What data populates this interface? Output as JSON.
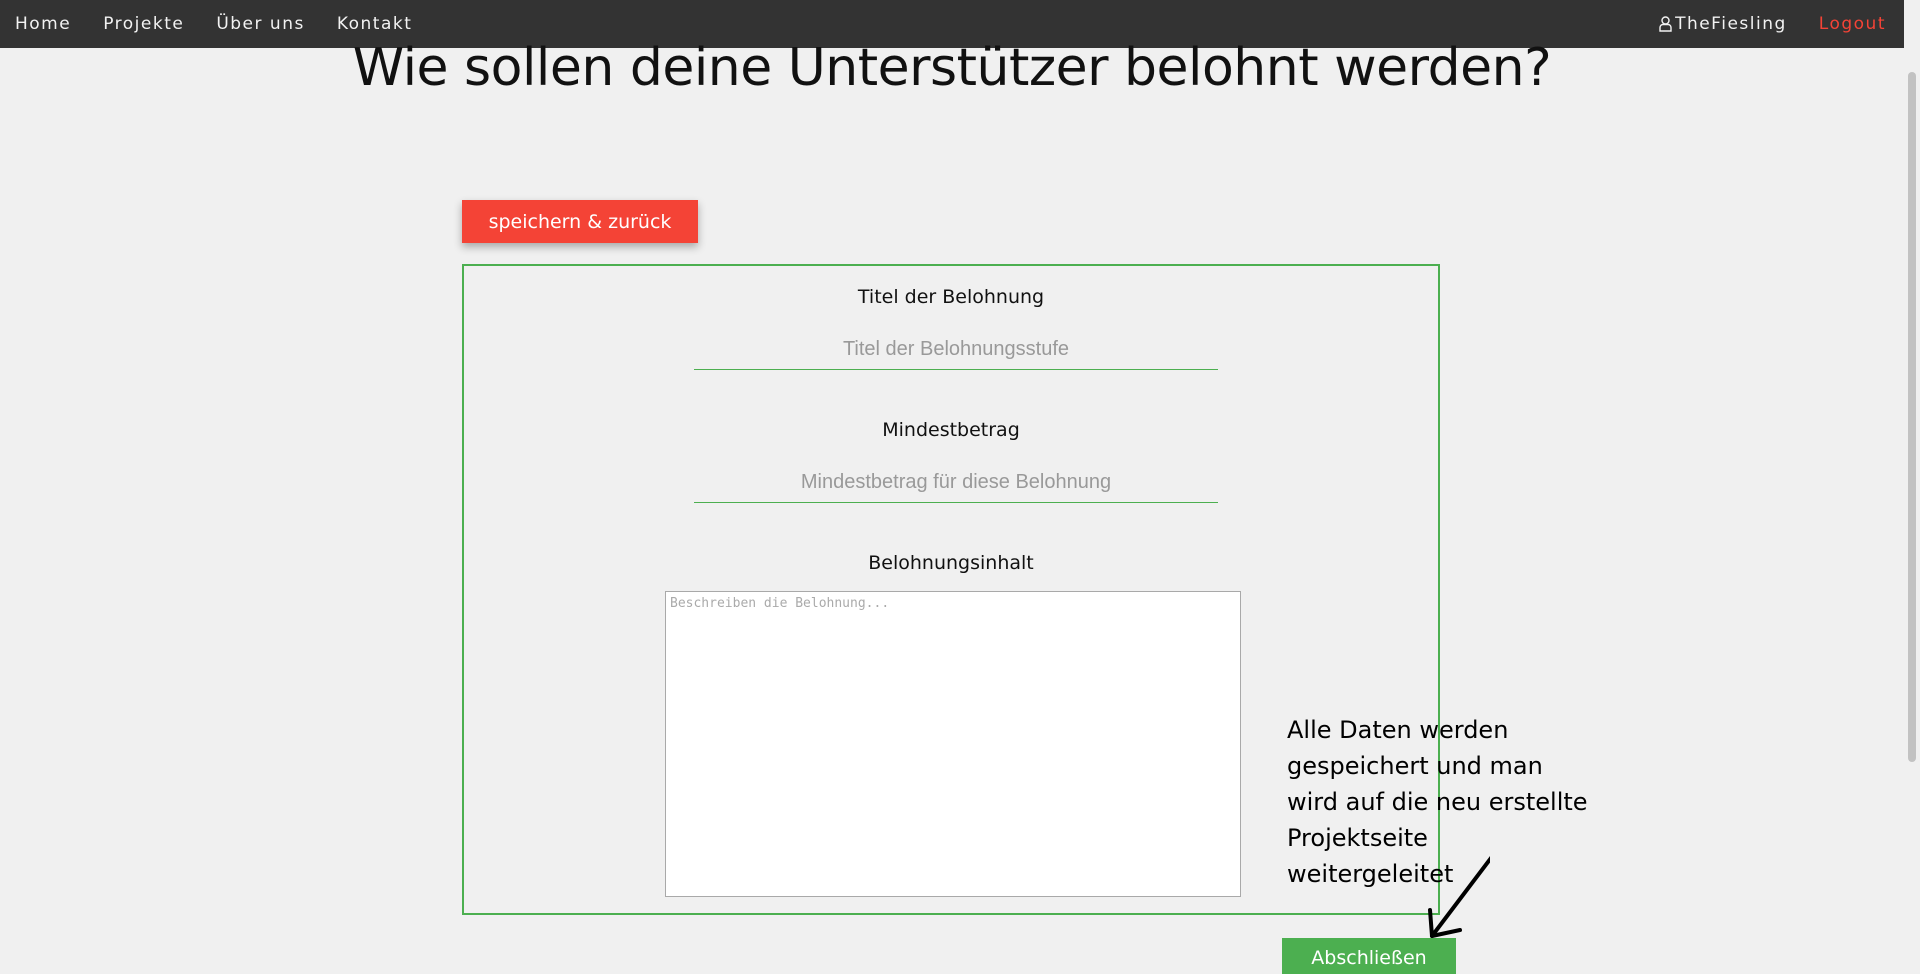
{
  "nav": {
    "left_items": [
      "Home",
      "Projekte",
      "Über uns",
      "Kontakt"
    ],
    "username": "TheFiesling",
    "logout": "Logout"
  },
  "page": {
    "title": "Wie sollen deine Unterstützer belohnt werden?"
  },
  "buttons": {
    "save_back": "speichern & zurück",
    "finish": "Abschließen"
  },
  "form": {
    "title_label": "Titel der Belohnung",
    "title_placeholder": "Titel der Belohnungsstufe",
    "min_label": "Mindestbetrag",
    "min_placeholder": "Mindestbetrag für diese Belohnung",
    "content_label": "Belohnungsinhalt",
    "content_placeholder": "Beschreiben die Belohnung..."
  },
  "annotation": {
    "lines": [
      "Alle Daten werden",
      "gespeichert und man",
      "wird auf die neu erstellte",
      "Projektseite",
      "weitergeleitet"
    ]
  },
  "colors": {
    "navbar": "#333333",
    "accent_red": "#f44336",
    "accent_green": "#4caf50",
    "background": "#f0f0f0"
  },
  "icons": {
    "user": "user-icon",
    "arrow": "arrow-annotation-icon"
  }
}
